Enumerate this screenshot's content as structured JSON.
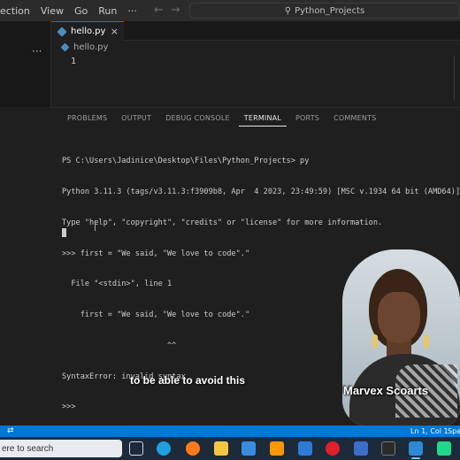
{
  "titlebar": {
    "menu": [
      "ection",
      "View",
      "Go",
      "Run",
      "···"
    ],
    "search_text": "Python_Projects"
  },
  "editor": {
    "tab_label": "hello.py",
    "breadcrumb": "hello.py",
    "line_numbers": [
      "1"
    ]
  },
  "panel": {
    "tabs": [
      "PROBLEMS",
      "OUTPUT",
      "DEBUG CONSOLE",
      "TERMINAL",
      "PORTS",
      "COMMENTS"
    ],
    "active_tab": "TERMINAL"
  },
  "terminal": {
    "lines": [
      "PS C:\\Users\\Jadinice\\Desktop\\Files\\Python_Projects> py",
      "Python 3.11.3 (tags/v3.11.3:f3909b8, Apr  4 2023, 23:49:59) [MSC v.1934 64 bit (AMD64)] on win32",
      "Type \"help\", \"copyright\", \"credits\" or \"license\" for more information.",
      ">>> first = \"We said, \"We love to code\".\"",
      "  File \"<stdin>\", line 1",
      "    first = \"We said, \"We love to code\".\"",
      "                       ^^",
      "SyntaxError: invalid syntax",
      ">>>"
    ]
  },
  "overlay": {
    "subtitle": "to be able to avoid this",
    "presenter_name": "Marvex Scoarts"
  },
  "statusbar": {
    "position": "Ln 1, Col 1",
    "spaces": "Spa"
  },
  "taskbar": {
    "search_placeholder": "ere to search",
    "icons": [
      "task-view-icon",
      "edge-icon",
      "firefox-icon",
      "file-explorer-icon",
      "store-icon",
      "sublime-icon",
      "mail-icon",
      "opera-icon",
      "python-icon",
      "terminal-icon",
      "vscode-icon",
      "pycharm-icon"
    ],
    "colors": {
      "edge": "#1fa0e0",
      "firefox": "#ff7a1a",
      "explorer": "#f5c542",
      "store": "#3a8dde",
      "sublime": "#ff9800",
      "mail": "#2e7bd6",
      "opera": "#e0202a",
      "python": "#3d6ec9",
      "terminal": "#2b2b2b",
      "vscode": "#2a8ad4",
      "pycharm": "#21d789"
    }
  }
}
